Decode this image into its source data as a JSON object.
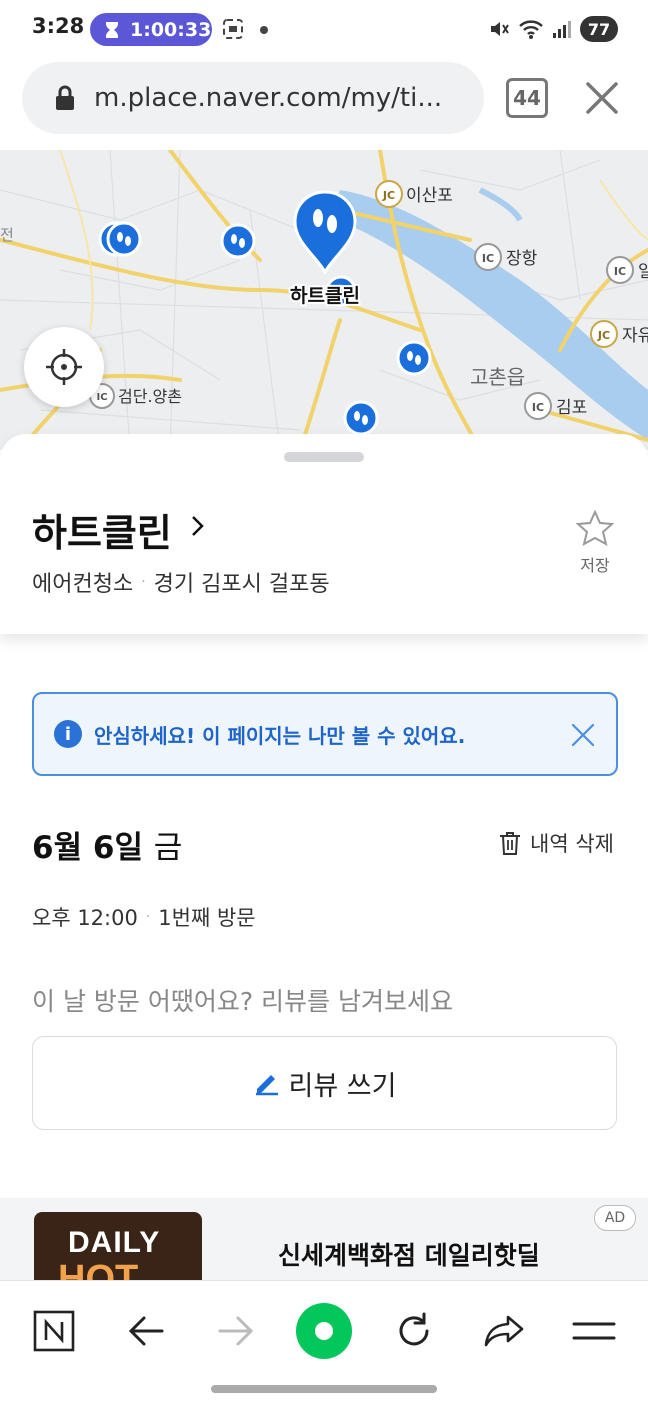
{
  "status_bar": {
    "time": "3:28",
    "timer": "1:00:33",
    "battery": "77"
  },
  "browser": {
    "url": "m.place.naver.com/my/ti...",
    "tab_count": "44"
  },
  "map": {
    "labels": {
      "isanpo": "이산포",
      "janghang": "장항",
      "geomdan": "검단.양촌",
      "gochon": "고촌읍",
      "gimpo": "김포",
      "jayu": "자유",
      "place_marker": "하트클린",
      "ic_right": "일"
    },
    "badges": {
      "jc": "JC",
      "ic": "IC"
    }
  },
  "place": {
    "name": "하트클린",
    "category": "에어컨청소",
    "address": "경기 김포시 걸포동",
    "save_label": "저장"
  },
  "notice": {
    "text": "안심하세요! 이 페이지는 나만 볼 수 있어요."
  },
  "visit": {
    "date": "6월 6일",
    "day_of_week": "금",
    "delete_label": "내역 삭제",
    "time": "오후 12:00",
    "visit_count": "1번째 방문",
    "review_prompt": "이 날 방문 어땠어요? 리뷰를 남겨보세요",
    "review_button": "리뷰 쓰기"
  },
  "ad": {
    "badge": "AD",
    "title": "신세계백화점 데일리핫딜",
    "thumb_line1": "DAILY",
    "thumb_line2": "HOT"
  },
  "colors": {
    "accent_blue": "#1f64c8",
    "marker_blue": "#1a6fdc",
    "river": "#a9cdee",
    "road_yellow": "#f2d26a",
    "timer_purple": "#5b57d6",
    "naver_green": "#03c75a"
  }
}
